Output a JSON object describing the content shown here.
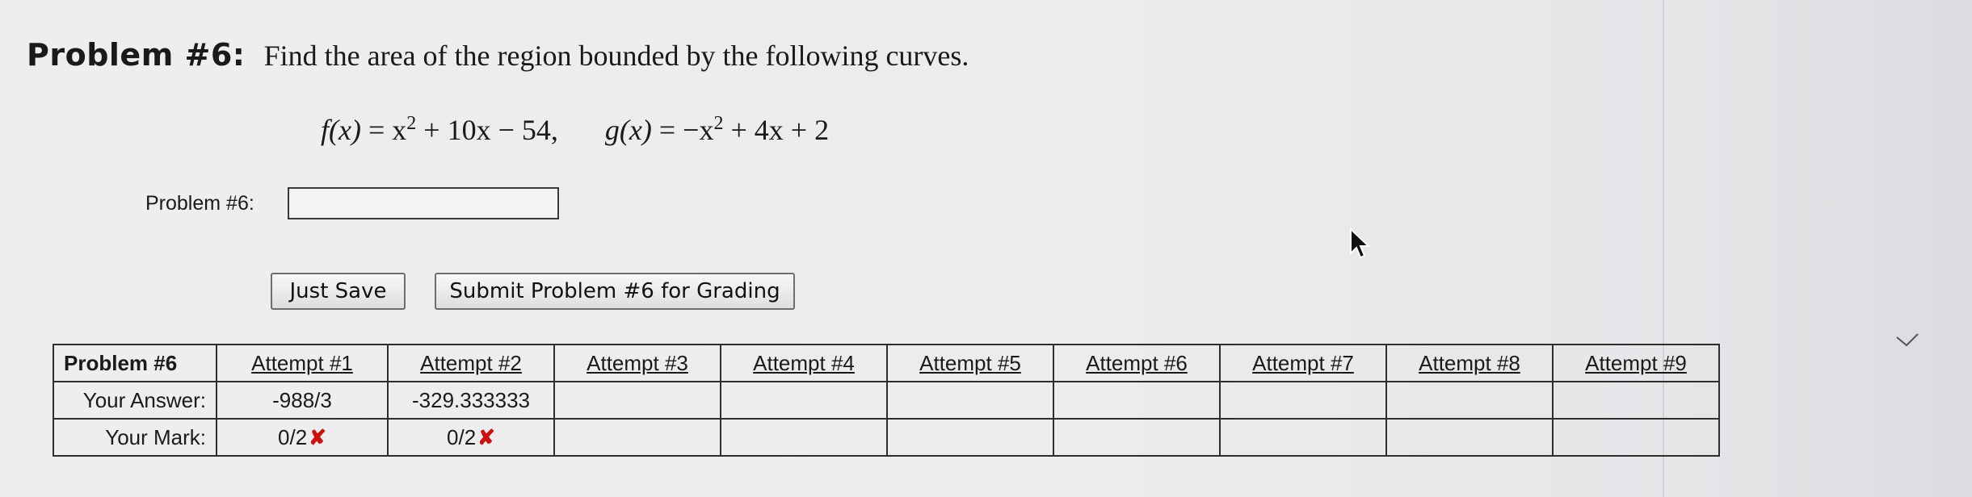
{
  "problem": {
    "label": "Problem #6:",
    "text": "Find the area of the region bounded by the following curves.",
    "equation": {
      "f_lhs": "f(x)",
      "f_rhs_a": "= x",
      "f_rhs_exp": "2",
      "f_rhs_b": "+ 10x − 54,",
      "g_lhs": "g(x)",
      "g_rhs_a": "= −x",
      "g_rhs_exp": "2",
      "g_rhs_b": "+ 4x + 2"
    }
  },
  "answer": {
    "label": "Problem #6:",
    "value": ""
  },
  "buttons": {
    "just_save": "Just Save",
    "submit": "Submit Problem #6 for Grading"
  },
  "table": {
    "corner": "Problem #6",
    "attempts": [
      "Attempt #1",
      "Attempt #2",
      "Attempt #3",
      "Attempt #4",
      "Attempt #5",
      "Attempt #6",
      "Attempt #7",
      "Attempt #8",
      "Attempt #9"
    ],
    "your_answer_label": "Your Answer:",
    "your_mark_label": "Your Mark:",
    "answers": [
      "-988/3",
      "-329.333333",
      "",
      "",
      "",
      "",
      "",
      "",
      ""
    ],
    "marks": [
      "0/2",
      "0/2",
      "",
      "",
      "",
      "",
      "",
      "",
      ""
    ],
    "mark_symbol": "✘"
  },
  "colors": {
    "wrong_mark": "#cc1111"
  },
  "icons": {
    "cursor": "mouse-pointer-icon",
    "check": "checkmark-icon"
  }
}
